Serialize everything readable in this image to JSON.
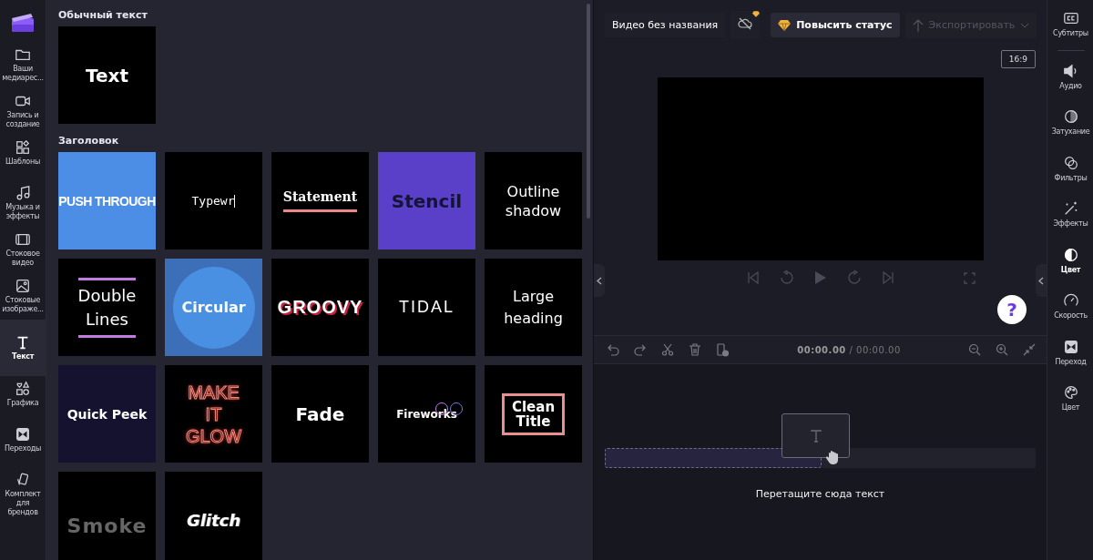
{
  "nav": [
    {
      "label": "Ваши медиарес...",
      "selected": false
    },
    {
      "label": "Запись и создание",
      "selected": false
    },
    {
      "label": "Шаблоны",
      "selected": false
    },
    {
      "label": "Музыка и эффекты",
      "selected": false
    },
    {
      "label": "Стоковое видео",
      "selected": false
    },
    {
      "label": "Стоковые изображе...",
      "selected": false
    },
    {
      "label": "Текст",
      "selected": true
    },
    {
      "label": "Графика",
      "selected": false
    },
    {
      "label": "Переходы",
      "selected": false
    },
    {
      "label": "Комплект для брендов",
      "selected": false
    }
  ],
  "sections": [
    {
      "title": "Обычный текст",
      "tiles": [
        {
          "text": "Text",
          "kind": "plain"
        }
      ]
    },
    {
      "title": "Заголовок",
      "tiles": [
        {
          "text": "PUSH THROUGH",
          "kind": "push"
        },
        {
          "text": "Typewr",
          "kind": "typewriter"
        },
        {
          "text": "Statement",
          "kind": "statement"
        },
        {
          "text": "Stencil",
          "kind": "stencil"
        },
        {
          "text": "Outline shadow",
          "kind": "outline"
        },
        {
          "text": "Double Lines",
          "kind": "double"
        },
        {
          "text": "Circular",
          "kind": "circular"
        },
        {
          "text": "GROOVY",
          "kind": "groovy"
        },
        {
          "text": "TIDAL",
          "kind": "tidal"
        },
        {
          "text": "Large heading",
          "kind": "large"
        },
        {
          "text": "Quick Peek",
          "kind": "peek"
        },
        {
          "text": "MAKE IT GLOW",
          "kind": "glow"
        },
        {
          "text": "Fade",
          "kind": "fade"
        },
        {
          "text": "Fireworks",
          "kind": "fireworks"
        },
        {
          "text": "Clean Title",
          "kind": "clean"
        },
        {
          "text": "Smoke",
          "kind": "smoke"
        },
        {
          "text": "Glitch",
          "kind": "glitch"
        }
      ]
    }
  ],
  "header": {
    "title": "Видео без названия",
    "upgrade": "Повысить статус",
    "export": {
      "label": "Экспортировать",
      "disabled": true
    },
    "ratio": "16:9"
  },
  "help": "?",
  "timeline": {
    "current": "00:00.00",
    "total": "/ 00:00.00",
    "hint": "Перетащите сюда текст"
  },
  "rail": [
    {
      "label": "Субтитры",
      "selected": false
    },
    {
      "label": "Аудио",
      "selected": false
    },
    {
      "label": "Затухание",
      "selected": false
    },
    {
      "label": "Фильтры",
      "selected": false
    },
    {
      "label": "Эффекты",
      "selected": false
    },
    {
      "label": "Цвет",
      "selected": true
    },
    {
      "label": "Скорость",
      "selected": false
    },
    {
      "label": "Переход",
      "selected": false
    },
    {
      "label": "Цвет",
      "selected": false
    }
  ]
}
